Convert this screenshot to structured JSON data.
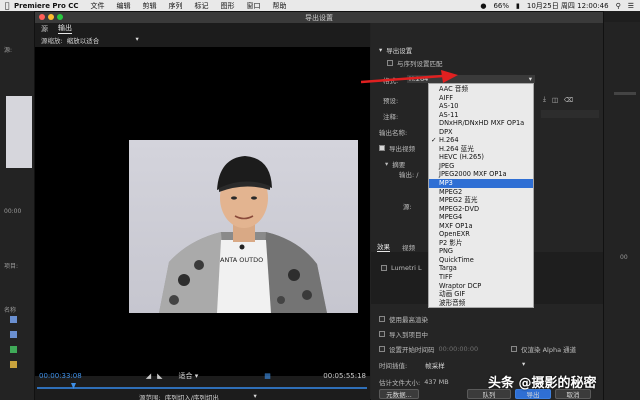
{
  "menubar": {
    "app_name": "Premiere Pro CC",
    "items": [
      "文件",
      "编辑",
      "剪辑",
      "序列",
      "标记",
      "图形",
      "窗口",
      "帮助"
    ],
    "battery": "66%",
    "datetime": "10月25日 周四 12:00:46"
  },
  "dialog": {
    "title": "导出设置",
    "left": {
      "tabs": [
        "源",
        "输出"
      ],
      "source_scale_label": "源缩放:",
      "source_scale_value": "缩放以适合",
      "timecode_current": "00:00:33:08",
      "fit_label": "适合",
      "timecode_end": "00:05:55:18",
      "source_range_label": "源范围:",
      "source_range_value": "序列切入/序列切出"
    },
    "right": {
      "section_title": "导出设置",
      "match_sequence_label": "与序列设置匹配",
      "format_label": "格式:",
      "format_value": "H.264",
      "preset_label": "预设:",
      "comment_label": "注释:",
      "output_name_label": "输出名称:",
      "export_video_label": "导出视频",
      "summary_label": "摘要",
      "output_label": "输出: /",
      "source_label": "源:",
      "tabs": [
        "效果",
        "视频"
      ],
      "lumetri_label": "Lumetri L",
      "max_render_label": "使用最高渲染",
      "import_project_label": "导入到项目中",
      "set_start_tc_label": "设置开始时间码",
      "start_tc_value": "00:00:00:00",
      "alpha_label": "仅渲染 Alpha 通道",
      "interp_label": "时间插值:",
      "interp_value": "帧采样",
      "filesize_label": "估计文件大小:",
      "filesize_value": "437 MB",
      "metadata_button": "元数据...",
      "queue_button": "队列",
      "export_button": "导出",
      "cancel_button": "取消"
    },
    "format_options": [
      "AAC 音频",
      "AIFF",
      "AS-10",
      "AS-11",
      "DNxHR/DNxHD MXF OP1a",
      "DPX",
      "H.264",
      "H.264 蓝光",
      "HEVC (H.265)",
      "JPEG",
      "JPEG2000 MXF OP1a",
      "MP3",
      "MPEG2",
      "MPEG2 蓝光",
      "MPEG2-DVD",
      "MPEG4",
      "MXF OP1a",
      "OpenEXR",
      "P2 影片",
      "PNG",
      "QuickTime",
      "Targa",
      "TIFF",
      "Wraptor DCP",
      "动画 GIF",
      "波形音频"
    ],
    "format_checked": "H.264",
    "format_highlighted": "MP3"
  },
  "photo_shirt_text": "ANTA OUTDO",
  "background": {
    "left_labels": [
      "源:",
      "00:00",
      "项目:",
      "名称"
    ],
    "right_label": "00"
  },
  "watermark": "头条 @摄影的秘密",
  "colors": {
    "accent_blue": "#2f6fd4",
    "timecode_blue": "#3e8fe6",
    "arrow_red": "#e02020"
  }
}
